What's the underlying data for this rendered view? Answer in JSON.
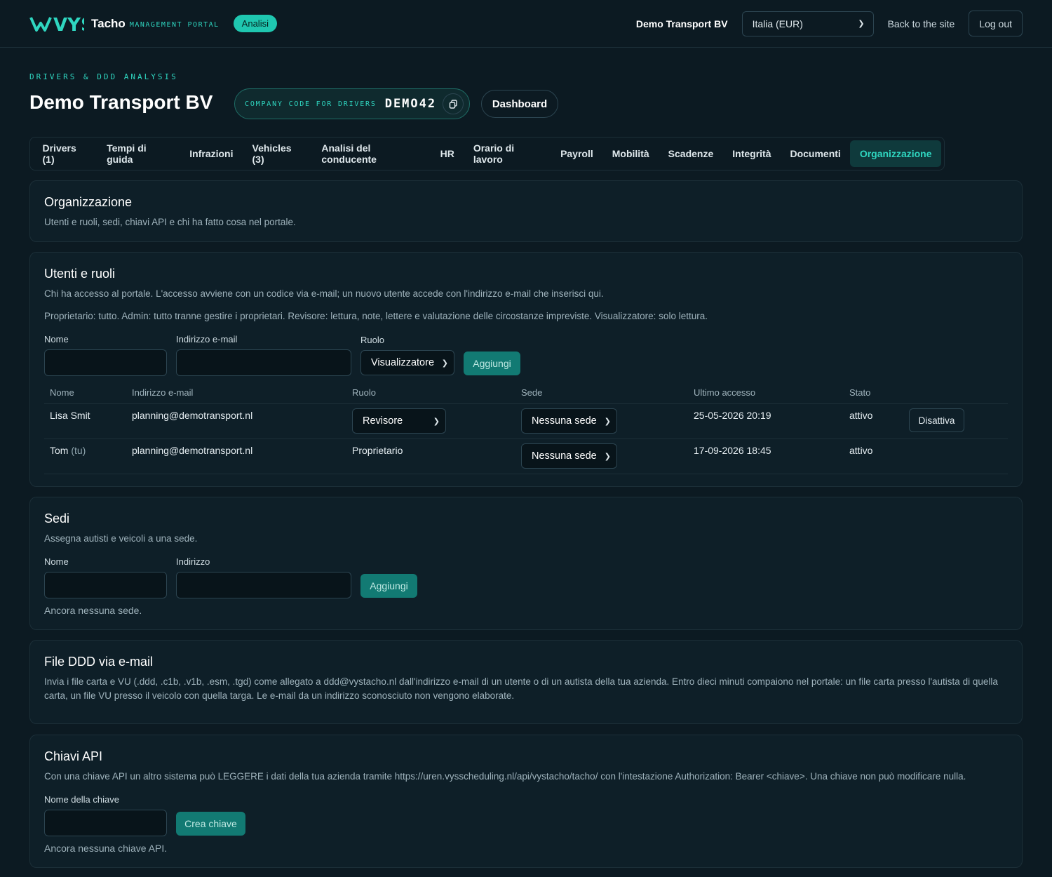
{
  "topbar": {
    "brand_mark": "VYS",
    "brand_word": "Tacho",
    "brand_sub": "MANAGEMENT PORTAL",
    "badge": "Analisi",
    "company": "Demo Transport BV",
    "country_select": "Italia (EUR)",
    "back_link": "Back to the site",
    "logout": "Log out"
  },
  "header": {
    "eyebrow": "DRIVERS & DDD ANALYSIS",
    "title": "Demo Transport BV",
    "code_label": "COMPANY CODE FOR DRIVERS",
    "code_value": "DEMO42",
    "dashboard": "Dashboard"
  },
  "tabs": [
    {
      "label": "Drivers (1)"
    },
    {
      "label": "Tempi di guida"
    },
    {
      "label": "Infrazioni"
    },
    {
      "label": "Vehicles (3)"
    },
    {
      "label": "Analisi del conducente"
    },
    {
      "label": "HR"
    },
    {
      "label": "Orario di lavoro"
    },
    {
      "label": "Payroll"
    },
    {
      "label": "Mobilità"
    },
    {
      "label": "Scadenze"
    },
    {
      "label": "Integrità"
    },
    {
      "label": "Documenti"
    },
    {
      "label": "Organizzazione"
    }
  ],
  "org": {
    "title": "Organizzazione",
    "desc": "Utenti e ruoli, sedi, chiavi API e chi ha fatto cosa nel portale."
  },
  "users": {
    "title": "Utenti e ruoli",
    "desc1": "Chi ha accesso al portale. L'accesso avviene con un codice via e-mail; un nuovo utente accede con l'indirizzo e-mail che inserisci qui.",
    "desc2": "Proprietario: tutto. Admin: tutto tranne gestire i proprietari. Revisore: lettura, note, lettere e valutazione delle circostanze impreviste. Visualizzatore: solo lettura.",
    "form": {
      "name_label": "Nome",
      "email_label": "Indirizzo e-mail",
      "role_label": "Ruolo",
      "role_value": "Visualizzatore",
      "add": "Aggiungi"
    },
    "columns": [
      "Nome",
      "Indirizzo e-mail",
      "Ruolo",
      "Sede",
      "Ultimo accesso",
      "Stato"
    ],
    "rows": [
      {
        "name": "Lisa Smit",
        "suffix": "",
        "email": "planning@demotransport.nl",
        "role": "Revisore",
        "site": "Nessuna sede",
        "last": "25-05-2026 20:19",
        "status": "attivo",
        "action": "Disattiva"
      },
      {
        "name": "Tom",
        "suffix": "(tu)",
        "email": "planning@demotransport.nl",
        "role": "Proprietario",
        "site": "Nessuna sede",
        "last": "17-09-2026 18:45",
        "status": "attivo",
        "action": ""
      }
    ]
  },
  "sites": {
    "title": "Sedi",
    "desc": "Assegna autisti e veicoli a una sede.",
    "name_label": "Nome",
    "address_label": "Indirizzo",
    "add": "Aggiungi",
    "empty": "Ancora nessuna sede."
  },
  "ddd": {
    "title": "File DDD via e-mail",
    "desc": "Invia i file carta e VU (.ddd, .c1b, .v1b, .esm, .tgd) come allegato a ddd@vystacho.nl dall'indirizzo e-mail di un utente o di un autista della tua azienda. Entro dieci minuti compaiono nel portale: un file carta presso l'autista di quella carta, un file VU presso il veicolo con quella targa. Le e-mail da un indirizzo sconosciuto non vengono elaborate."
  },
  "api": {
    "title": "Chiavi API",
    "desc": "Con una chiave API un altro sistema può LEGGERE i dati della tua azienda tramite https://uren.vysscheduling.nl/api/vystacho/tacho/ con l'intestazione Authorization: Bearer <chiave>. Una chiave non può modificare nulla.",
    "key_label": "Nome della chiave",
    "create": "Crea chiave",
    "empty": "Ancora nessuna chiave API."
  },
  "colors": {
    "accent": "#2fd6c0",
    "background": "#0c1a22",
    "card": "#0e1f28",
    "button": "#127a73"
  }
}
